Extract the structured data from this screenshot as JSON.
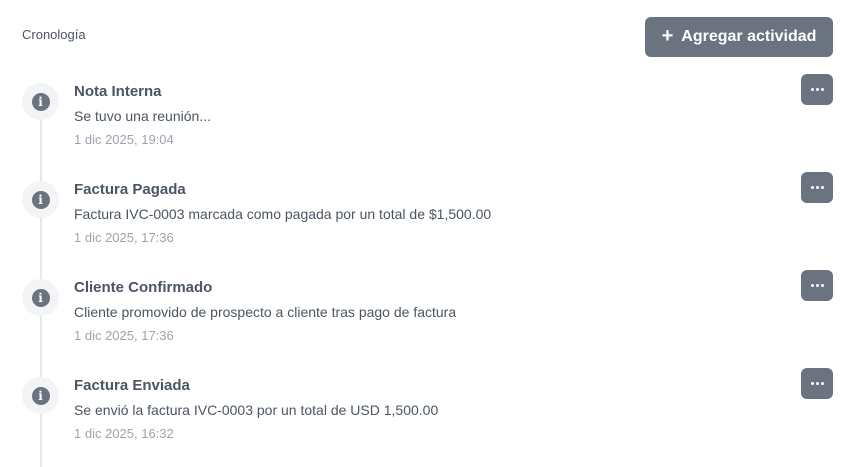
{
  "timeline": {
    "title": "Cronología",
    "add_button": {
      "icon": "plus-icon",
      "label": "Agregar actividad"
    },
    "colors": {
      "accent": "#6b7280",
      "muted": "#9ca3af",
      "line": "#e5e7eb"
    },
    "items": [
      {
        "icon": "info-icon",
        "title": "Nota Interna",
        "description": "Se tuvo una reunión...",
        "timestamp": "1 dic 2025, 19:04"
      },
      {
        "icon": "info-icon",
        "title": "Factura Pagada",
        "description": "Factura IVC-0003 marcada como pagada por un total de $1,500.00",
        "timestamp": "1 dic 2025, 17:36"
      },
      {
        "icon": "info-icon",
        "title": "Cliente Confirmado",
        "description": "Cliente promovido de prospecto a cliente tras pago de factura",
        "timestamp": "1 dic 2025, 17:36"
      },
      {
        "icon": "info-icon",
        "title": "Factura Enviada",
        "description": "Se envió la factura IVC-0003 por un total de USD 1,500.00",
        "timestamp": "1 dic 2025, 16:32"
      }
    ]
  }
}
